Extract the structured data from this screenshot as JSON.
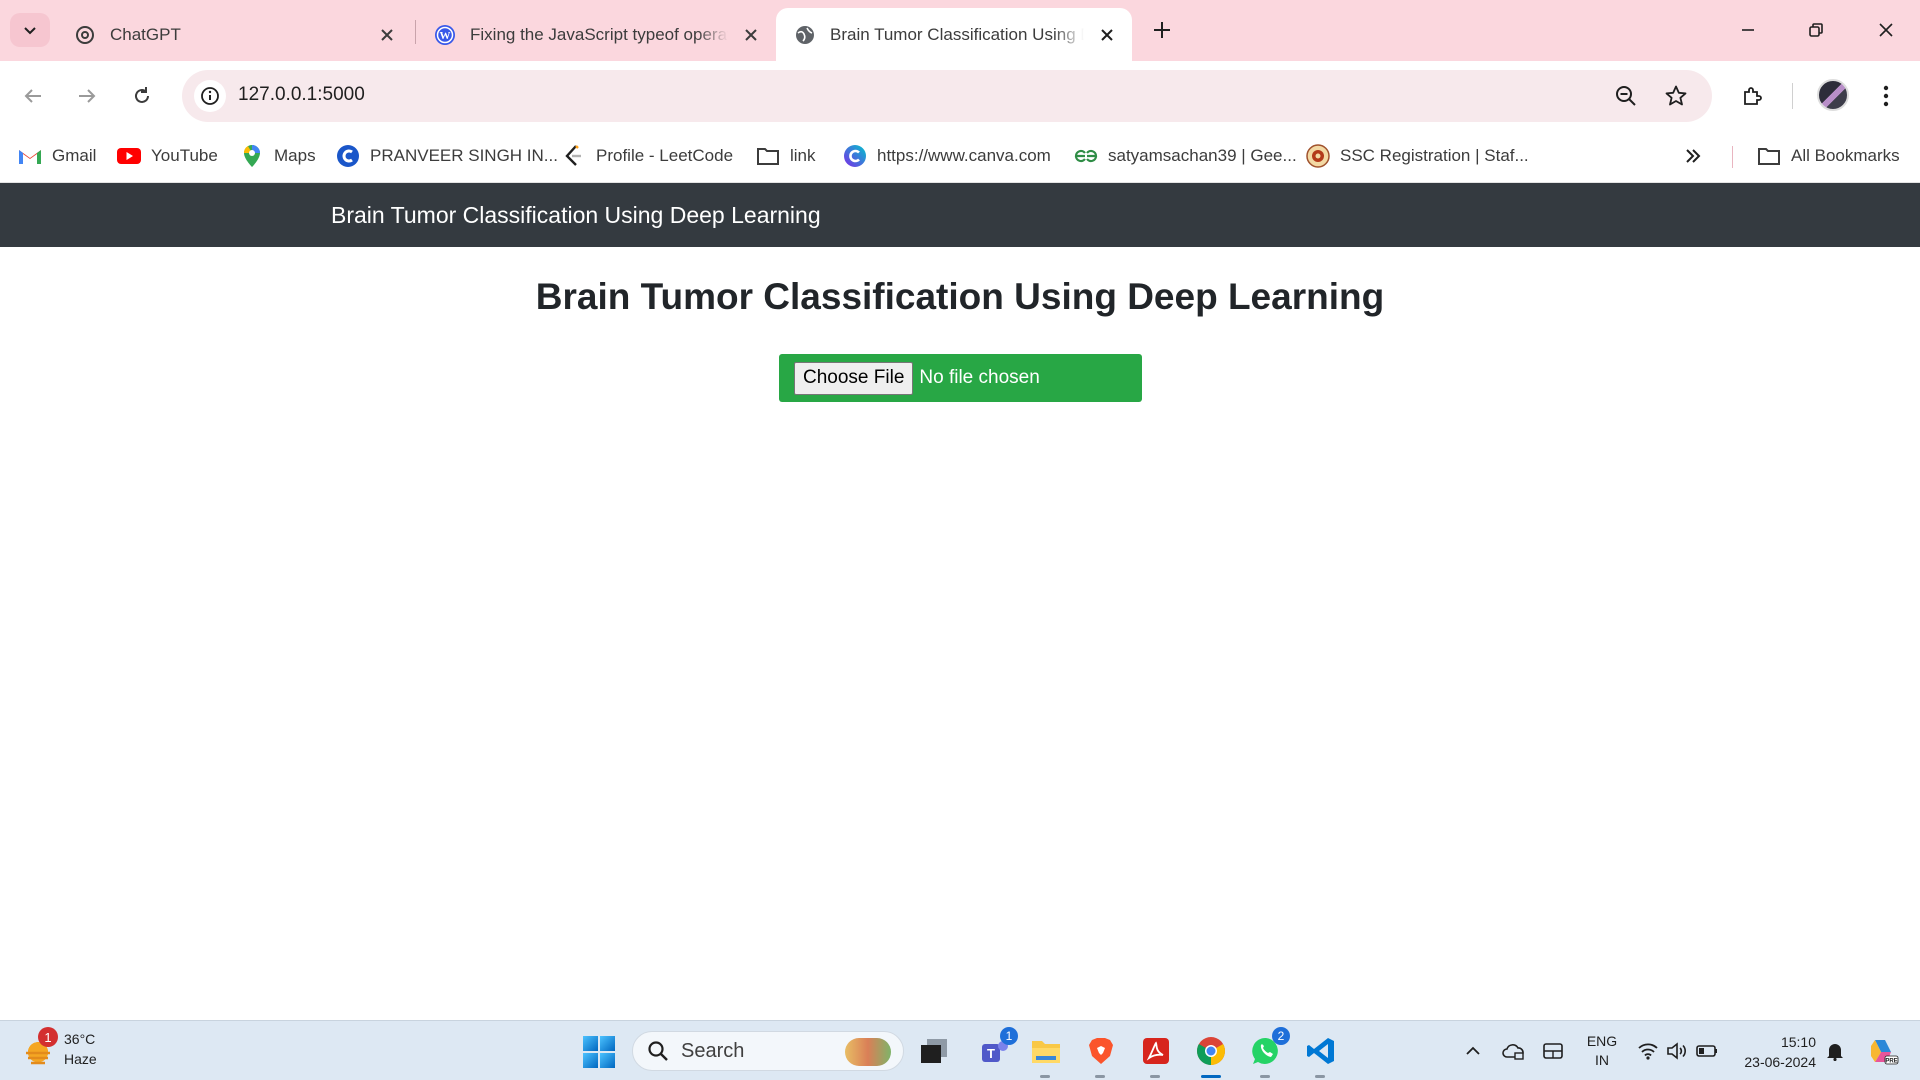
{
  "browser": {
    "tabs": [
      {
        "title": "ChatGPT",
        "icon": "chatgpt-icon",
        "active": false
      },
      {
        "title": "Fixing the JavaScript typeof operat",
        "icon": "wordpress-icon",
        "active": false
      },
      {
        "title": "Brain Tumor Classification Using D",
        "icon": "globe-icon",
        "active": true
      }
    ],
    "url": "127.0.0.1:5000",
    "bookmarks": [
      {
        "label": "Gmail",
        "icon": "gmail-icon"
      },
      {
        "label": "YouTube",
        "icon": "youtube-icon"
      },
      {
        "label": "Maps",
        "icon": "maps-icon"
      },
      {
        "label": "PRANVEER SINGH IN...",
        "icon": "college-icon"
      },
      {
        "label": "Profile - LeetCode",
        "icon": "leetcode-icon"
      },
      {
        "label": "link",
        "icon": "folder-icon"
      },
      {
        "label": "https://www.canva.com",
        "icon": "canva-icon"
      },
      {
        "label": "satyamsachan39 | Gee...",
        "icon": "geeksforgeeks-icon"
      },
      {
        "label": "SSC Registration | Staf...",
        "icon": "ssc-icon"
      }
    ],
    "all_bookmarks_label": "All Bookmarks",
    "colors": {
      "tabstrip": "#fbd7de",
      "omnibox": "#f7e9ec"
    }
  },
  "page": {
    "navbar_brand": "Brain Tumor Classification Using Deep Learning",
    "heading": "Brain Tumor Classification Using Deep Learning",
    "upload": {
      "button_label": "Choose File",
      "status": "No file chosen"
    },
    "colors": {
      "navbar": "#343a40",
      "upload_bg": "#28a745"
    }
  },
  "taskbar": {
    "weather": {
      "temp": "36°C",
      "condition": "Haze",
      "badge": "1"
    },
    "search_label": "Search",
    "apps": [
      {
        "name": "task-view-icon",
        "running": false
      },
      {
        "name": "teams-icon",
        "running": false,
        "badge": "1"
      },
      {
        "name": "file-explorer-icon",
        "running": true
      },
      {
        "name": "brave-icon",
        "running": true
      },
      {
        "name": "acrobat-icon",
        "running": true
      },
      {
        "name": "chrome-icon",
        "running": true,
        "active": true
      },
      {
        "name": "whatsapp-icon",
        "running": true,
        "badge": "2"
      },
      {
        "name": "vscode-icon",
        "running": true
      }
    ],
    "language": {
      "line1": "ENG",
      "line2": "IN"
    },
    "clock": {
      "time": "15:10",
      "date": "23-06-2024"
    }
  }
}
